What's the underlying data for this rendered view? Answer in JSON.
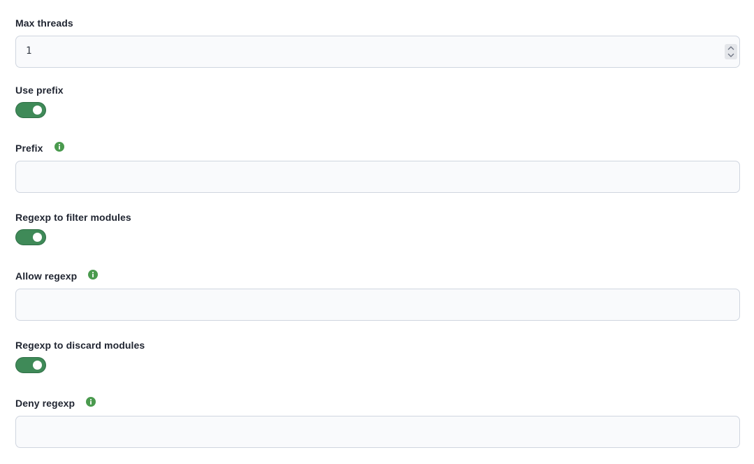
{
  "form": {
    "max_threads": {
      "label": "Max threads",
      "value": "1"
    },
    "use_prefix": {
      "label": "Use prefix",
      "enabled": true
    },
    "prefix": {
      "label": "Prefix",
      "value": "",
      "icon": "info-icon"
    },
    "regexp_filter": {
      "label": "Regexp to filter modules",
      "enabled": true
    },
    "allow_regexp": {
      "label": "Allow regexp",
      "value": "",
      "icon": "info-icon"
    },
    "regexp_discard": {
      "label": "Regexp to discard modules",
      "enabled": true
    },
    "deny_regexp": {
      "label": "Deny regexp",
      "value": "",
      "icon": "info-icon"
    }
  },
  "colors": {
    "toggle_on": "#3f8a58",
    "info_icon": "#4a9a4e",
    "input_border": "#cfd5df",
    "input_background": "#f9fafc"
  }
}
